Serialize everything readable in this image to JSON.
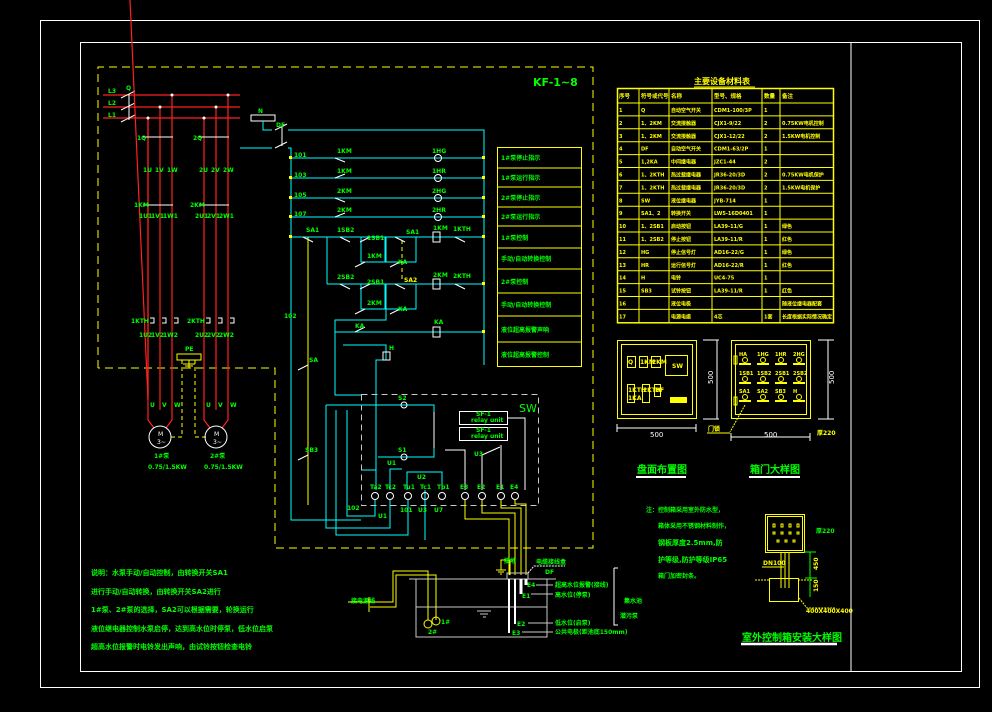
{
  "drawing": {
    "cabinet_model": "KF-1~8",
    "colors": {
      "background": "#000000",
      "text": "#00ff00",
      "frame": "#ffffff",
      "boundary": "#ffff00",
      "power": "#ff2020",
      "control": "#00ffff",
      "level_box": "#c8c8c8"
    },
    "power": {
      "phases": [
        "L3",
        "L2",
        "L1"
      ],
      "neutral": "N",
      "main_breaker": "Q",
      "breaker_1": "1Q",
      "breaker_2": "2Q",
      "mid_1": [
        "1U",
        "1V",
        "1W"
      ],
      "mid_2": [
        "2U",
        "2V",
        "2W"
      ],
      "contactor_1": "1KM",
      "contactor_2": "2KM",
      "out_1": [
        "1U1",
        "1V1",
        "1W1"
      ],
      "out_2": [
        "2U1",
        "2V1",
        "2W1"
      ],
      "thermal_1": "1KTH",
      "thermal_2": "2KTH",
      "thout_1": [
        "1U2",
        "1V2",
        "1W2"
      ],
      "thout_2": [
        "2U2",
        "2V2",
        "2W2"
      ],
      "pe": "PE",
      "term_1": [
        "U",
        "V",
        "W"
      ],
      "term_2": [
        "U",
        "V",
        "W"
      ],
      "motor_symbol": [
        "M",
        "3~"
      ],
      "motor_1_name": "1#泵",
      "motor_2_name": "2#泵",
      "motor_1_power": "0.75/1.5KW",
      "motor_2_power": "0.75/1.5KW"
    },
    "control": {
      "neutral_terminal": "N",
      "control_breaker": "DF",
      "wire_labels": [
        "101",
        "103",
        "105",
        "107",
        "102"
      ],
      "lamps": [
        "1HG",
        "1HR",
        "2HG",
        "2HR"
      ],
      "contacts_top": [
        "1KM",
        "1KM",
        "2KM",
        "2KM"
      ],
      "sa1": "SA1",
      "sa1b": "SA1",
      "sb_1": [
        "1SB2",
        "1SB1"
      ],
      "sb_2": [
        "2SB2",
        "2SB1"
      ],
      "sa2": "SA2",
      "coil_1": "1KM",
      "coil_2": "2KM",
      "th_1": "1KTH",
      "th_2": "2KTH",
      "hold_1": "1KM",
      "hold_2": "2KM",
      "ka_labels": [
        "KA",
        "KA",
        "KA",
        "KA"
      ],
      "bell": "H",
      "sa_bottom": "SA",
      "sb3": "SB3",
      "wire_n": "N"
    },
    "function_labels": [
      "1#泵停止指示",
      "1#泵运行指示",
      "2#泵停止指示",
      "2#泵运行指示",
      "1#泵控制",
      "手动/自动转换控制",
      "2#泵控制",
      "手动/自动转换控制",
      "液位超高报警声响",
      "液位超高报警控制"
    ],
    "sw": {
      "label": "SW",
      "relay_units": [
        {
          "model": "SF-1",
          "text": "relay unit"
        },
        {
          "model": "SF-1",
          "text": "relay unit"
        }
      ],
      "supply": [
        "S2",
        "S1"
      ],
      "contacts": [
        "U1",
        "U2",
        "U3"
      ],
      "terminals": [
        "Ta2",
        "Tc2",
        "Tu1",
        "Tc1",
        "Tb1",
        "E3",
        "E2",
        "E1",
        "E4"
      ],
      "wire_labels": [
        "102",
        "U1",
        "101",
        "U3",
        "U7"
      ]
    },
    "tank": {
      "cable_label": "接电源线",
      "ground_label": "接地",
      "junction_label": "电缆接线盒",
      "junction_code": "DF",
      "electrodes": [
        {
          "code": "E4",
          "label": "超高水位报警(接线)"
        },
        {
          "code": "E1",
          "label": "高水位(停泵)"
        },
        {
          "code": "E2",
          "label": "低水位(启泵)"
        },
        {
          "code": "E3",
          "label": "公共电极(距池底150mm)"
        }
      ],
      "pumps": [
        "1#",
        "2#"
      ],
      "pit_note": [
        "集水池",
        "潜污泵"
      ]
    },
    "material_table": {
      "title": "主要设备材料表",
      "headers": [
        "序号",
        "符号或代号",
        "名称",
        "型号、规格",
        "数量",
        "备注"
      ],
      "rows": [
        [
          "1",
          "Q",
          "自动空气开关",
          "CDM1-100/3P",
          "1",
          ""
        ],
        [
          "2",
          "1、2KM",
          "交流接触器",
          "CJX1-9/22",
          "2",
          "0.75KW电机控制"
        ],
        [
          "3",
          "1、2KM",
          "交流接触器",
          "CJX1-12/22",
          "2",
          "1.5KW电机控制"
        ],
        [
          "4",
          "DF",
          "自动空气开关",
          "CDM1-63/2P",
          "1",
          ""
        ],
        [
          "5",
          "1,2KA",
          "中间继电器",
          "JZC1-44",
          "2",
          ""
        ],
        [
          "6",
          "1、2KTH",
          "热过载继电器",
          "JR36-20/3D",
          "2",
          "0.75KW电机保护"
        ],
        [
          "7",
          "1、2KTH",
          "热过载继电器",
          "JR36-20/3D",
          "2",
          "1.5KW电机保护"
        ],
        [
          "8",
          "SW",
          "液位继电器",
          "JYB-714",
          "1",
          ""
        ],
        [
          "9",
          "SA1、2",
          "转换开关",
          "LW5-16D0401",
          "1",
          ""
        ],
        [
          "10",
          "1、2SB1",
          "启动按钮",
          "LA39-11/G",
          "1",
          "绿色"
        ],
        [
          "11",
          "1、2SB2",
          "停止按钮",
          "LA39-11/R",
          "1",
          "红色"
        ],
        [
          "12",
          "HG",
          "停止信号灯",
          "AD16-22/G",
          "1",
          "绿色"
        ],
        [
          "13",
          "HR",
          "运行信号灯",
          "AD16-22/R",
          "1",
          "红色"
        ],
        [
          "14",
          "H",
          "电铃",
          "UC4-75",
          "1",
          ""
        ],
        [
          "15",
          "SB3",
          "试铃按钮",
          "LA39-11/R",
          "1",
          "红色"
        ],
        [
          "16",
          "",
          "液位电极",
          "",
          "",
          "随液位继电器配套"
        ],
        [
          "17",
          "",
          "电源电缆",
          "4芯",
          "1套",
          "长度根据实际情况确定"
        ]
      ]
    },
    "panel_layout": {
      "title": "盘面布置图",
      "devices": [
        "Q",
        "1KM",
        "2KM",
        "SW",
        "1KTH",
        "2KTH",
        "DF",
        "1KA"
      ],
      "width": "500",
      "height": "500"
    },
    "door_detail": {
      "title": "箱门大样图",
      "row1": [
        "HA",
        "1HG",
        "1HR",
        "2HG"
      ],
      "row2": [
        "1SB1",
        "1SB2",
        "2SB1",
        "2SB2"
      ],
      "row3": [
        "SA1",
        "SA2",
        "SB3",
        "H"
      ],
      "lock_label": "门锁",
      "width": "500",
      "height": "500",
      "depth": "厚220"
    },
    "install_detail": {
      "title": "室外控制箱安装大样图",
      "depth": "厚220",
      "pipe": "DN100",
      "h1": "450",
      "h2": "150",
      "base": "400X400X400"
    },
    "notes_right": [
      "注：控制箱采用室外防水型，",
      "箱体采用不锈钢材料制作，",
      "钢板厚度2.5mm,防",
      "护等级,防护等级IP65",
      "箱门加密封条。"
    ],
    "notes_left": [
      "说明：水泵手动/自动控制，由转换开关SA1",
      "进行手动/自动转换，由转换开关SA2进行",
      "1#泵、2#泵的选择，SA2可以根据需要，轮换运行",
      "液位继电器控制水泵启停，达到高水位时停泵，低水位启泵",
      "超高水位报警时电铃发出声响，由试铃按钮检查电铃"
    ]
  }
}
